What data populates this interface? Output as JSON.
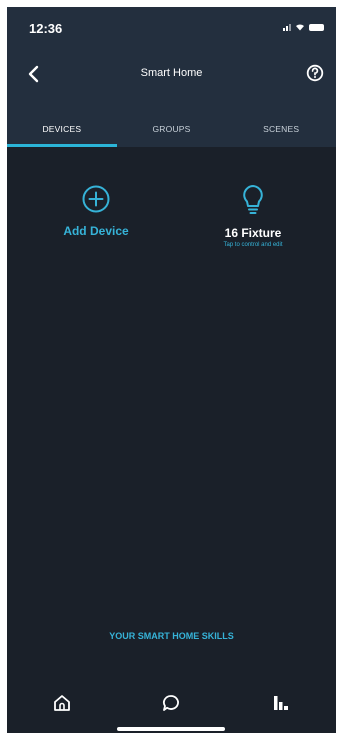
{
  "status_bar": {
    "time": "12:36"
  },
  "header": {
    "title": "Smart Home",
    "back_icon": "back-arrow-icon",
    "help_icon": "help-icon"
  },
  "tabs": [
    {
      "label": "DEVICES",
      "active": true
    },
    {
      "label": "GROUPS",
      "active": false
    },
    {
      "label": "SCENES",
      "active": false
    }
  ],
  "tiles": {
    "add_device": {
      "label": "Add Device",
      "icon": "plus-circle-icon"
    },
    "fixture": {
      "label": "16 Fixture",
      "subtext": "Tap to control and edit",
      "icon": "lightbulb-icon"
    }
  },
  "skills_link": {
    "label": "YOUR SMART HOME SKILLS"
  },
  "bottom_nav": [
    {
      "name": "home",
      "icon": "home-icon"
    },
    {
      "name": "communicate",
      "icon": "chat-bubble-icon"
    },
    {
      "name": "devices",
      "icon": "devices-icon"
    }
  ],
  "colors": {
    "background": "#1a2029",
    "header": "#232f3e",
    "accent": "#36b3d8",
    "tab_underline": "#2bb5d8",
    "text": "#ffffff"
  }
}
